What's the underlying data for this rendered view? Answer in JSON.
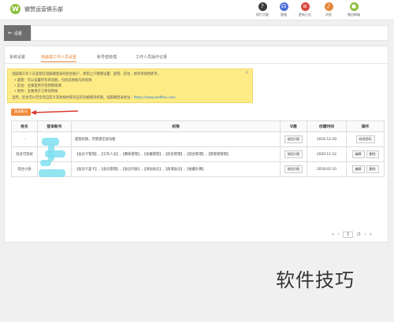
{
  "app": {
    "name": "微赞运营俱乐部",
    "logo_letter": "W"
  },
  "top_icons": [
    {
      "label": "帮忙问题",
      "icon": "question-icon",
      "color": "#3a3a3a",
      "glyph": "?"
    },
    {
      "label": "客服",
      "icon": "headset-icon",
      "color": "#4a6fd8",
      "glyph": "☊"
    },
    {
      "label": "更新日志",
      "icon": "log-icon",
      "color": "#d9463e",
      "glyph": "≡"
    },
    {
      "label": "消息",
      "icon": "bell-icon",
      "color": "#e6883a",
      "glyph": "♪"
    },
    {
      "label": "撤回邮箱",
      "icon": "user-icon",
      "color": "#8dbf3c",
      "glyph": "●"
    }
  ],
  "back_button": {
    "label": "设置"
  },
  "tabs": [
    {
      "label": "系统设置"
    },
    {
      "label": "电脑端工作人员设置"
    },
    {
      "label": "账号借管理"
    },
    {
      "label": "工作人员操作记录"
    }
  ],
  "notice": {
    "line1": "电脑端工作人员是指在电脑端登录的后台账户，原则上只需要设置：超管、前台、财务等角色即可。",
    "line2": "• 超管：可以设置所有的功能，包括其他账号的权限",
    "line3": "• 前台：主要是用于签到和销课",
    "line4": "• 财务：主要用于订单的审核",
    "line5": "当然，您也可以完全的自定义其他角色和对应的功能模块权限。电脑端登录地址：",
    "link": "https://www.wefitos.com"
  },
  "add_button": {
    "label": "添加账号"
  },
  "table": {
    "headers": [
      "姓名",
      "登录账号",
      "权限",
      "U盾",
      "创建时间",
      "操作"
    ],
    "rows": [
      {
        "name": "-",
        "account": "",
        "perm": "超管权限，可管理全部功能",
        "ukey": "绑定U盾",
        "created": "2016-12-20",
        "ops": [
          "修改密码"
        ]
      },
      {
        "name": "前台可测试",
        "account": "",
        "perm": "【会员卡管理】,【工作人员】,【教练管理】,【会籍管理】,【前台管理】,【前台管理】,【管理者管理】",
        "ukey": "绑定U盾",
        "created": "2020-11-12",
        "ops": [
          "编辑",
          "删除"
        ]
      },
      {
        "name": "前台小张",
        "account": "",
        "perm": "【会员卡盒卡】,【会员管理】,【会员列表】,【添加会员】,【商城会员】,【拍摄头像】",
        "ukey": "绑定U盾",
        "created": "2018-02-10",
        "ops": [
          "编辑",
          "删除"
        ]
      }
    ]
  },
  "pager": {
    "prev_first": "«",
    "prev": "‹",
    "page": "1",
    "total": "/1",
    "next": "›",
    "next_last": "»"
  },
  "watermark": "软件技巧"
}
